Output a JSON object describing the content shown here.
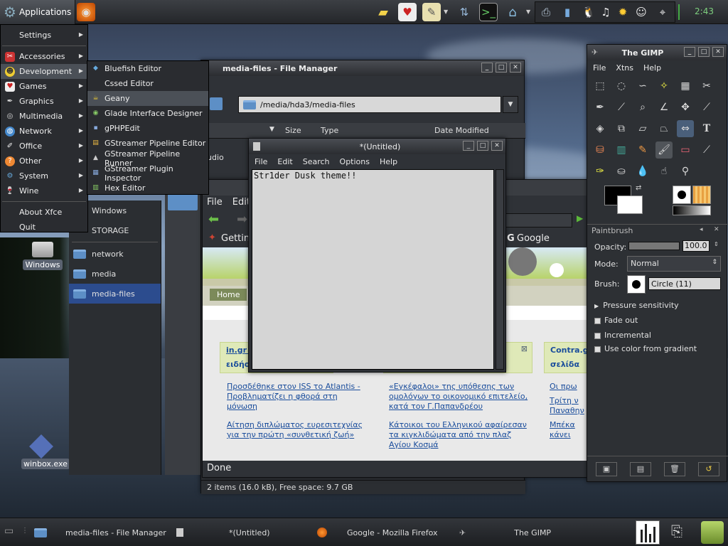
{
  "top_panel": {
    "app_menu_label": "Applications",
    "clock": "2:43",
    "launchers": [
      "firefox-icon",
      "folder-icon",
      "cards-icon",
      "notepad-icon",
      "network-icon",
      "terminal-icon",
      "home-folder-icon",
      "printer-icon",
      "chart-icon",
      "tux-icon",
      "music-icon",
      "sun-icon",
      "monkey-icon",
      "mouse-icon"
    ]
  },
  "app_menu": {
    "items": [
      {
        "label": "Settings",
        "submenu": true,
        "icon": ""
      },
      {
        "label": "Accessories",
        "submenu": true,
        "icon": "accessories-icon"
      },
      {
        "label": "Development",
        "submenu": true,
        "icon": "development-icon"
      },
      {
        "label": "Games",
        "submenu": true,
        "icon": "games-icon"
      },
      {
        "label": "Graphics",
        "submenu": true,
        "icon": "graphics-icon"
      },
      {
        "label": "Multimedia",
        "submenu": true,
        "icon": "multimedia-icon"
      },
      {
        "label": "Network",
        "submenu": true,
        "icon": "network-icon"
      },
      {
        "label": "Office",
        "submenu": true,
        "icon": "office-icon"
      },
      {
        "label": "Other",
        "submenu": true,
        "icon": "other-icon"
      },
      {
        "label": "System",
        "submenu": true,
        "icon": "system-icon"
      },
      {
        "label": "Wine",
        "submenu": true,
        "icon": "wine-icon"
      },
      {
        "label": "About Xfce",
        "submenu": false,
        "icon": ""
      },
      {
        "label": "Quit",
        "submenu": false,
        "icon": ""
      }
    ]
  },
  "dev_submenu": {
    "items": [
      "Bluefish Editor",
      "Cssed Editor",
      "Geany",
      "Glade Interface Designer",
      "gPHPEdit",
      "GStreamer Pipeline Editor",
      "GStreamer Pipeline Runner",
      "GStreamer Plugin Inspector",
      "Hex Editor"
    ],
    "highlighted": "Geany"
  },
  "desktop_icons": {
    "windows": "Windows",
    "winbox": "winbox.exe"
  },
  "file_manager": {
    "title": "media-files - File Manager",
    "path": "/media/hda3/media-files",
    "columns": [
      "Size",
      "Type",
      "Date Modified"
    ],
    "partial_row": "udio",
    "sidebar": [
      "Windows",
      "STORAGE",
      "network",
      "media",
      "media-files"
    ],
    "selected": "media-files",
    "status": "2 items (16.0 kB), Free space: 9.7 GB"
  },
  "firefox": {
    "menu": [
      "File",
      "Edit"
    ],
    "bookmark_partial": "Getting",
    "google_tab": "Google",
    "home_tab": "Home",
    "status": "Done",
    "col1_header": "in.gr >",
    "col1_sub": "ειδήσ",
    "col2_header": "",
    "col3_header": "Contra.gr",
    "col3_sub": "σελίδα",
    "news_col1": [
      "Προσδέθηκε στον ISS το Atlantis - Προβληματίζει η φθορά στη μόνωση",
      "Αίτηση διπλώματος ευρεσιτεχνίας για την πρώτη «συνθετική ζωή»"
    ],
    "news_col2": [
      "«Εγκέφαλοι» της υπόθεσης των ομολόγων το οικονομικό επιτελείο, κατά τον Γ.Παπανδρέου",
      "Κάτοικοι του Ελληνικού αφαίρεσαν τα κιγκλιδώματα από την πλαζ Αγίου Κοσμά"
    ],
    "news_col3": [
      "Οι πρω",
      "Τρίτη ν Παναθην",
      "Μπέκα κάνει"
    ]
  },
  "mousepad": {
    "title": "*(Untitled)",
    "menu": [
      "File",
      "Edit",
      "Search",
      "Options",
      "Help"
    ],
    "content": "Str1der Dusk theme!!"
  },
  "gimp": {
    "title": "The GIMP",
    "menu": [
      "File",
      "Xtns",
      "Help"
    ],
    "tool_options_title": "Paintbrush",
    "opacity_label": "Opacity:",
    "opacity_value": "100.0",
    "opacity_fraction": 1.0,
    "mode_label": "Mode:",
    "mode_value": "Normal",
    "brush_label": "Brush:",
    "brush_value": "Circle (11)",
    "pressure": "Pressure sensitivity",
    "checks": [
      "Fade out",
      "Incremental",
      "Use color from gradient"
    ]
  },
  "taskbar": {
    "tasks": [
      "media-files - File Manager",
      "*(Untitled)",
      "Google - Mozilla Firefox",
      "The GIMP"
    ]
  }
}
